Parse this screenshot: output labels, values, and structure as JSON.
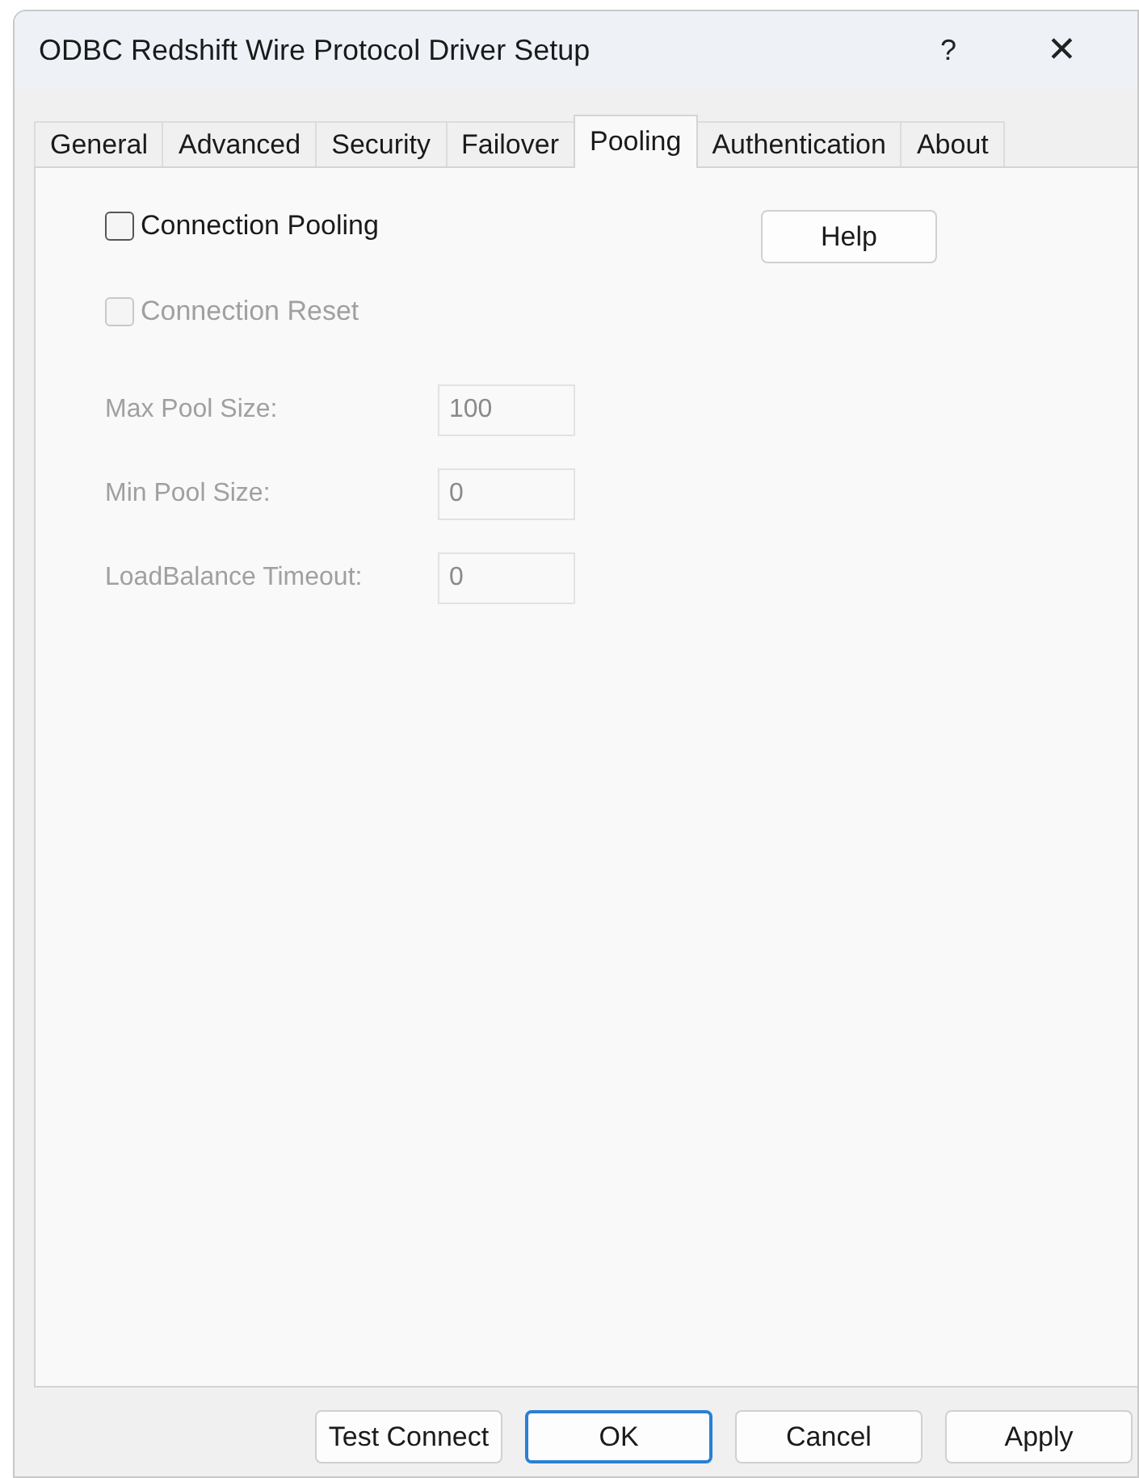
{
  "window": {
    "title": "ODBC Redshift Wire Protocol Driver Setup",
    "help_glyph": "?",
    "close_glyph": "✕"
  },
  "tabs": [
    {
      "label": "General",
      "selected": false
    },
    {
      "label": "Advanced",
      "selected": false
    },
    {
      "label": "Security",
      "selected": false
    },
    {
      "label": "Failover",
      "selected": false
    },
    {
      "label": "Pooling",
      "selected": true
    },
    {
      "label": "Authentication",
      "selected": false
    },
    {
      "label": "About",
      "selected": false
    }
  ],
  "checkboxes": [
    {
      "label": "Connection Pooling",
      "checked": false,
      "disabled": false
    },
    {
      "label": "Connection Reset",
      "checked": false,
      "disabled": true
    }
  ],
  "help_button": "Help",
  "fields": [
    {
      "label": "Max Pool Size:",
      "value": "100",
      "disabled": true
    },
    {
      "label": "Min Pool Size:",
      "value": "0",
      "disabled": true
    },
    {
      "label": "LoadBalance Timeout:",
      "value": "0",
      "disabled": true
    }
  ],
  "buttons": [
    {
      "label": "Test Connect",
      "default": false
    },
    {
      "label": "OK",
      "default": true
    },
    {
      "label": "Cancel",
      "default": false
    },
    {
      "label": "Apply",
      "default": false
    }
  ]
}
